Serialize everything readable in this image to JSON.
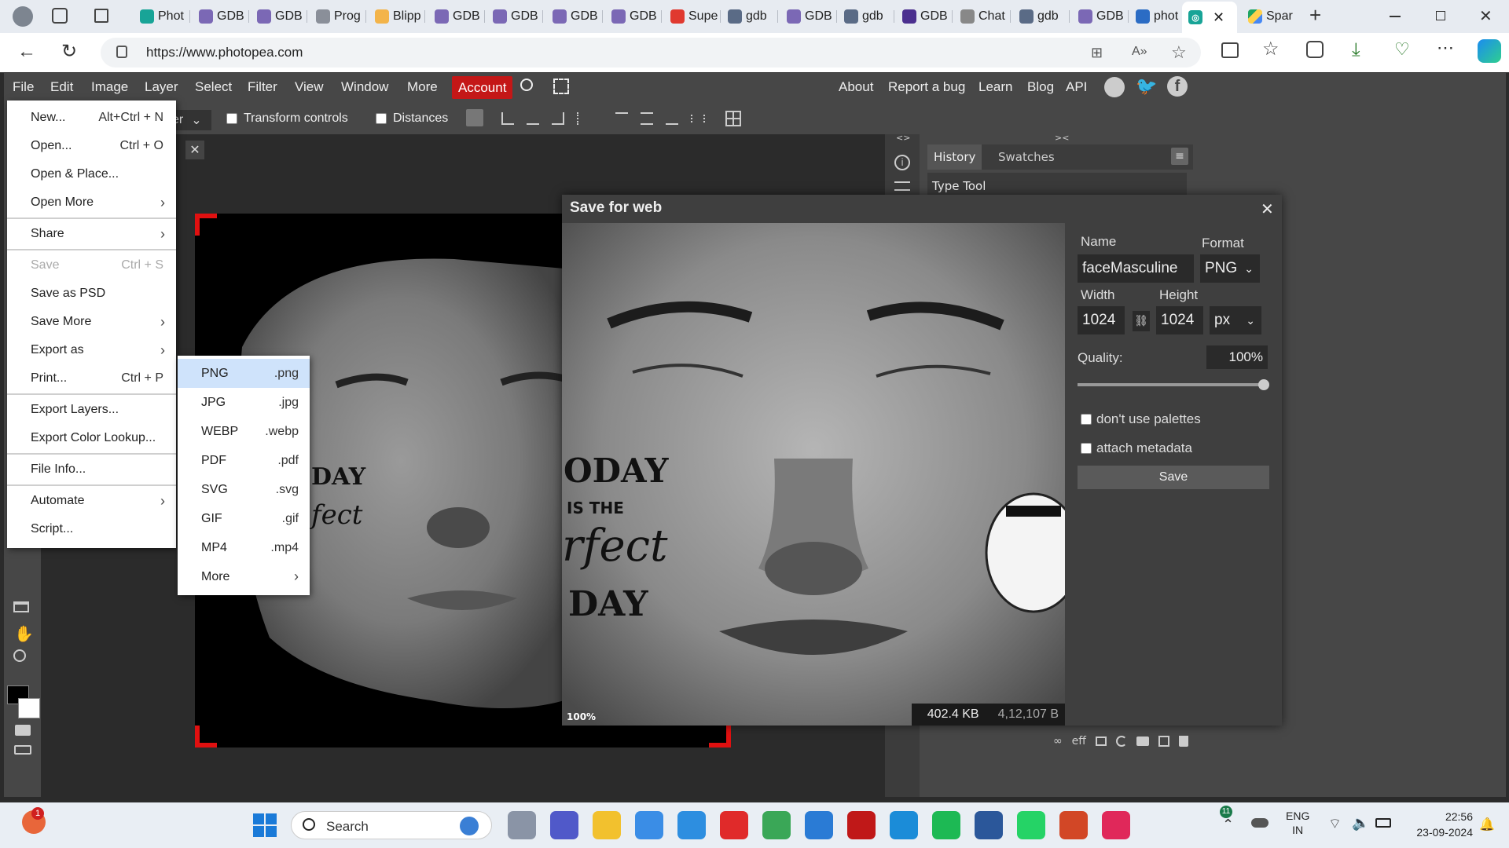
{
  "browser": {
    "tabs": [
      {
        "label": "Phot",
        "icon": "photopea-icon",
        "color": "#18a497"
      },
      {
        "label": "GDB",
        "icon": "gdb-icon",
        "color": "#7b68b5"
      },
      {
        "label": "GDB",
        "icon": "gdb-icon",
        "color": "#7b68b5"
      },
      {
        "label": "Prog",
        "icon": "globe-icon",
        "color": "#8a8f99"
      },
      {
        "label": "Blipp",
        "icon": "blipp-icon",
        "color": "#f3b44a"
      },
      {
        "label": "GDB",
        "icon": "gdb-icon",
        "color": "#7b68b5"
      },
      {
        "label": "GDB",
        "icon": "gdb-icon",
        "color": "#7b68b5"
      },
      {
        "label": "GDB",
        "icon": "gdb-icon",
        "color": "#7b68b5"
      },
      {
        "label": "GDB",
        "icon": "gdb-icon",
        "color": "#7b68b5"
      },
      {
        "label": "Supe",
        "icon": "youtube-icon",
        "color": "#e0392f"
      },
      {
        "label": "gdb",
        "icon": "search-icon",
        "color": "#5a6b86"
      },
      {
        "label": "GDB",
        "icon": "gdb-icon",
        "color": "#7b68b5"
      },
      {
        "label": "gdb",
        "icon": "search-icon",
        "color": "#5a6b86"
      },
      {
        "label": "GDB",
        "icon": "gdb-icon",
        "color": "#4b2f8f"
      },
      {
        "label": "Chat",
        "icon": "chatgpt-icon",
        "color": "#888888"
      },
      {
        "label": "gdb",
        "icon": "search-icon",
        "color": "#5a6b86"
      },
      {
        "label": "GDB",
        "icon": "gdb-icon",
        "color": "#7b68b5"
      },
      {
        "label": "phot",
        "icon": "search-icon",
        "color": "#2b6cc4"
      }
    ],
    "active_tab": {
      "icon": "photopea-icon",
      "close": "✕"
    },
    "next_tab": {
      "label": "Spar",
      "icon": "drive-icon"
    },
    "new_tab": "+",
    "url": "https://www.photopea.com"
  },
  "menubar": {
    "items": [
      "File",
      "Edit",
      "Image",
      "Layer",
      "Select",
      "Filter",
      "View",
      "Window",
      "More"
    ],
    "account": "Account",
    "right": [
      "About",
      "Report a bug",
      "Learn",
      "Blog",
      "API"
    ]
  },
  "toolopts": {
    "dropdown_tail": "er",
    "transform_controls": "Transform controls",
    "distances": "Distances"
  },
  "file_menu": [
    {
      "label": "New...",
      "shortcut": "Alt+Ctrl + N"
    },
    {
      "label": "Open...",
      "shortcut": "Ctrl + O"
    },
    {
      "label": "Open & Place..."
    },
    {
      "label": "Open More",
      "submenu": true
    },
    {
      "sep": true
    },
    {
      "label": "Share",
      "submenu": true
    },
    {
      "sep": true
    },
    {
      "label": "Save",
      "shortcut": "Ctrl + S",
      "disabled": true
    },
    {
      "label": "Save as PSD"
    },
    {
      "label": "Save More",
      "submenu": true
    },
    {
      "label": "Export as",
      "submenu": true
    },
    {
      "label": "Print...",
      "shortcut": "Ctrl + P"
    },
    {
      "sep": true
    },
    {
      "label": "Export Layers..."
    },
    {
      "label": "Export Color Lookup..."
    },
    {
      "sep": true
    },
    {
      "label": "File Info..."
    },
    {
      "sep": true
    },
    {
      "label": "Automate",
      "submenu": true
    },
    {
      "label": "Script..."
    }
  ],
  "export_menu": [
    {
      "label": "PNG",
      "ext": ".png"
    },
    {
      "label": "JPG",
      "ext": ".jpg"
    },
    {
      "label": "WEBP",
      "ext": ".webp"
    },
    {
      "label": "PDF",
      "ext": ".pdf"
    },
    {
      "label": "SVG",
      "ext": ".svg"
    },
    {
      "label": "GIF",
      "ext": ".gif"
    },
    {
      "label": "MP4",
      "ext": ".mp4"
    },
    {
      "label": "More",
      "submenu": true
    }
  ],
  "panel": {
    "tabs": [
      "History",
      "Swatches"
    ],
    "history_items": [
      "Type Tool"
    ]
  },
  "dialog": {
    "title": "Save for web",
    "name_label": "Name",
    "name_value": "faceMasculine",
    "format_label": "Format",
    "format_value": "PNG",
    "width_label": "Width",
    "width_value": "1024",
    "height_label": "Height",
    "height_value": "1024",
    "unit_value": "px",
    "quality_label": "Quality:",
    "quality_value": "100%",
    "quality_level": 1.0,
    "opt1": "don't use palettes",
    "opt2": "attach metadata",
    "save": "Save",
    "zoom": "100%",
    "size_kb": "402.4 KB",
    "size_b": "4,12,107 B"
  },
  "taskbar": {
    "search": "Search",
    "lang1": "ENG",
    "lang2": "IN",
    "time": "22:56",
    "date": "23-09-2024",
    "badge_user": "1",
    "badge_whatsapp": "11"
  },
  "colors": {
    "accent_account": "#c41717",
    "menu_highlight": "#cfe3fb",
    "panel_bg": "#474747",
    "crop_corner": "#e01010"
  }
}
